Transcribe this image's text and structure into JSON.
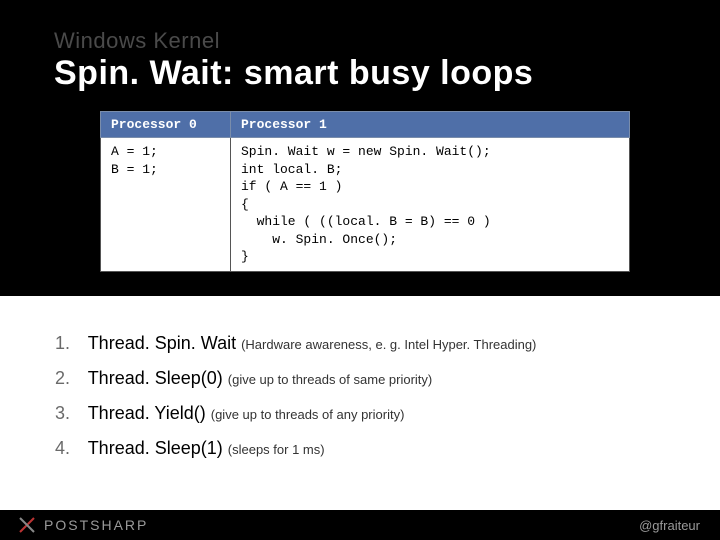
{
  "header": {
    "kicker": "Windows Kernel",
    "title": "Spin. Wait: smart busy loops"
  },
  "table": {
    "headers": [
      "Processor 0",
      "Processor 1"
    ],
    "cells": [
      "A = 1;\nB = 1;",
      "Spin. Wait w = new Spin. Wait();\nint local. B;\nif ( A == 1 )\n{\n  while ( ((local. B = B) == 0 )\n    w. Spin. Once();\n}"
    ]
  },
  "list": [
    {
      "method": "Thread. Spin. Wait ",
      "note": "(Hardware awareness, e. g. Intel Hyper. Threading)"
    },
    {
      "method": "Thread. Sleep(0) ",
      "note": "(give up to threads of same priority)"
    },
    {
      "method": "Thread. Yield() ",
      "note": "(give up to threads of any priority)"
    },
    {
      "method": "Thread. Sleep(1) ",
      "note": "(sleeps for 1 ms)"
    }
  ],
  "footer": {
    "brand": "POSTSHARP",
    "handle": "@gfraiteur"
  }
}
